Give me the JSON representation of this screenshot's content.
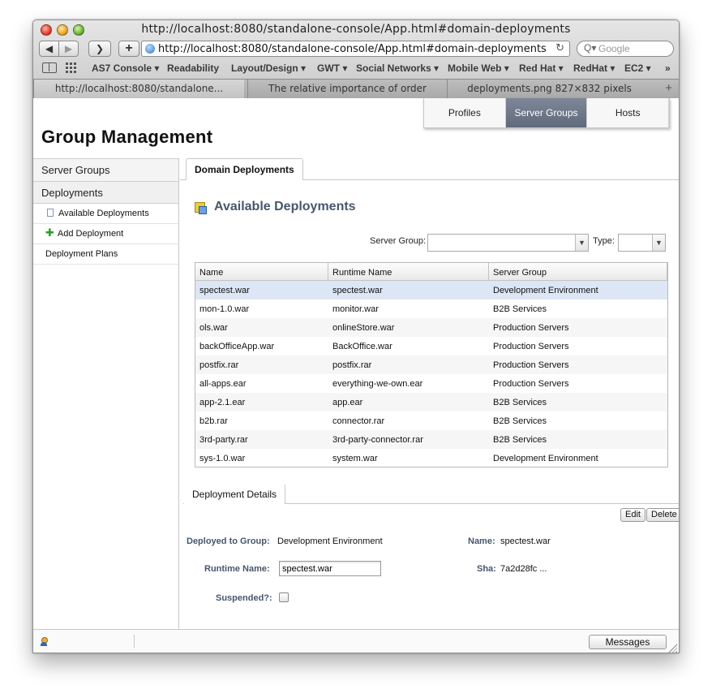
{
  "window": {
    "title": "http://localhost:8080/standalone-console/App.html#domain-deployments"
  },
  "toolbar": {
    "back": "◀",
    "forward": "▶",
    "reader": "❯",
    "add_tab": "+",
    "url": "http://localhost:8080/standalone-console/App.html#domain-deployments",
    "reload": "↻",
    "search_placeholder": "Google",
    "search_glyph": "Q▾"
  },
  "bookmarks": [
    "AS7 Console ▾",
    "Readability",
    "Layout/Design ▾",
    "GWT ▾",
    "Social Networks ▾",
    "Mobile Web ▾",
    "Red Hat ▾",
    "RedHat ▾",
    "EC2 ▾",
    "»"
  ],
  "tabs": [
    "http://localhost:8080/standalone...",
    "The relative importance of order",
    "deployments.png 827×832 pixels"
  ],
  "tab_plus": "+",
  "top_nav": {
    "items": [
      "Profiles",
      "Server Groups",
      "Hosts"
    ],
    "active": "Server Groups"
  },
  "page_title": "Group Management",
  "sidebar": {
    "sections": [
      "Server Groups",
      "Deployments"
    ],
    "items": [
      "Available Deployments",
      "Add Deployment",
      "Deployment Plans"
    ]
  },
  "content_tab": "Domain Deployments",
  "available": {
    "title": "Available Deployments",
    "server_group_label": "Server Group:",
    "server_group_value": "",
    "type_label": "Type:",
    "type_value": ""
  },
  "table": {
    "columns": [
      "Name",
      "Runtime Name",
      "Server Group"
    ],
    "rows": [
      [
        "spectest.war",
        "spectest.war",
        "Development Environment"
      ],
      [
        "mon-1.0.war",
        "monitor.war",
        "B2B Services"
      ],
      [
        "ols.war",
        "onlineStore.war",
        "Production Servers"
      ],
      [
        "backOfficeApp.war",
        "BackOffice.war",
        "Production Servers"
      ],
      [
        "postfix.rar",
        "postfix.rar",
        "Production Servers"
      ],
      [
        "all-apps.ear",
        "everything-we-own.ear",
        "Production Servers"
      ],
      [
        "app-2.1.ear",
        "app.ear",
        "B2B Services"
      ],
      [
        "b2b.rar",
        "connector.rar",
        "B2B Services"
      ],
      [
        "3rd-party.rar",
        "3rd-party-connector.rar",
        "B2B Services"
      ],
      [
        "sys-1.0.war",
        "system.war",
        "Development Environment"
      ]
    ],
    "selected_row": 0
  },
  "details": {
    "tab": "Deployment Details",
    "edit": "Edit",
    "delete": "Delete",
    "deployed_to_group_label": "Deployed to Group:",
    "deployed_to_group_value": "Development Environment",
    "name_label": "Name:",
    "name_value": "spectest.war",
    "runtime_name_label": "Runtime Name:",
    "runtime_name_value": "spectest.war",
    "sha_label": "Sha:",
    "sha_value": "7a2d28fc ...",
    "suspended_label": "Suspended?:",
    "suspended": false
  },
  "footer": {
    "messages": "Messages"
  },
  "colors": {
    "accent": "#46576d",
    "nav_active": "#6b7586",
    "selected_row": "#dce6f5",
    "add_icon": "#2a9d2a"
  }
}
